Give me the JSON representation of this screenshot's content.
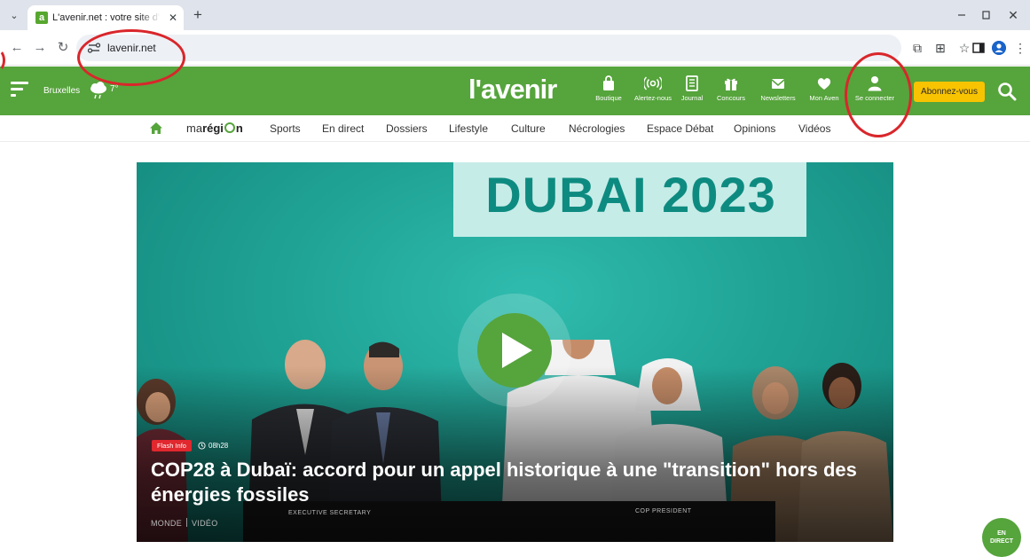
{
  "browser": {
    "tab_title": "L'avenir.net : votre site d'actualité",
    "favicon_letter": "a",
    "new_tab": "+",
    "url": "lavenir.net"
  },
  "header": {
    "city": "Bruxelles",
    "temperature": "7°",
    "logo": "l'avenir",
    "items": [
      {
        "label": "Boutique",
        "icon": "shopping-bag-icon"
      },
      {
        "label": "Alertez-nous",
        "icon": "signal-icon"
      },
      {
        "label": "Journal",
        "icon": "newspaper-icon"
      },
      {
        "label": "Concours",
        "icon": "gift-icon"
      },
      {
        "label": "Newsletters",
        "icon": "envelope-icon"
      },
      {
        "label": "Mon Aven",
        "icon": "heart-icon"
      },
      {
        "label": "Se connecter",
        "icon": "user-icon"
      }
    ],
    "subscribe": "Abonnez-vous"
  },
  "nav": {
    "region_prefix": "ma",
    "region_bold_a": "régi",
    "region_bold_b": "n",
    "links": [
      "Sports",
      "En direct",
      "Dossiers",
      "Lifestyle",
      "Culture",
      "Nécrologies",
      "Espace Débat",
      "Opinions",
      "Vidéos"
    ]
  },
  "hero": {
    "banner": "DUBAI 2023",
    "badge": "Flash Info",
    "time": "08h28",
    "headline": "COP28 à Dubaï: accord pour un appel historique à une \"transition\" hors des énergies fossiles",
    "tag_1": "MONDE",
    "tag_2": "VIDÉO",
    "podium_left": "EXECUTIVE SECRETARY",
    "podium_right": "COP PRESIDENT"
  },
  "live_badge": {
    "line1": "EN",
    "line2": "DIRECT"
  },
  "colors": {
    "brand_green": "#56a43c",
    "subscribe_yellow": "#f8c300",
    "flash_red": "#e0282e",
    "annotation_red": "#d9262b"
  }
}
